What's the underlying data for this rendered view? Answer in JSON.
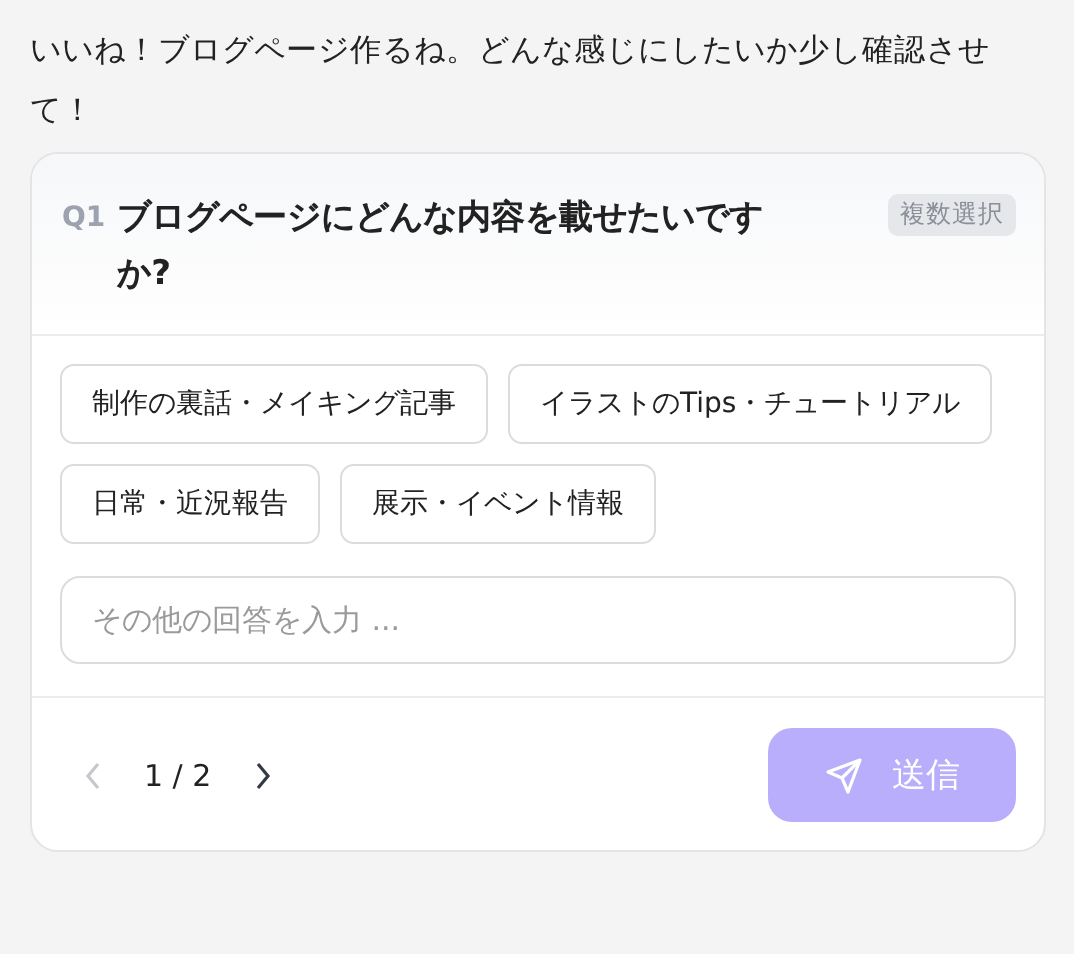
{
  "message": "いいね！ブログページ作るね。どんな感じにしたいか少し確認させて！",
  "question": {
    "number": "Q1",
    "title": "ブログページにどんな内容を載せたいですか?",
    "badge": "複数選択"
  },
  "options": [
    {
      "label": "制作の裏話・メイキング記事",
      "selected": false
    },
    {
      "label": "イラストのTips・チュートリアル",
      "selected": false
    },
    {
      "label": "日常・近況報告",
      "selected": false
    },
    {
      "label": "展示・イベント情報",
      "selected": false
    }
  ],
  "other_input": {
    "placeholder": "その他の回答を入力 ..."
  },
  "pager": {
    "text": "1 / 2",
    "prev_disabled": true,
    "next_disabled": false
  },
  "send_button": {
    "label": "送信",
    "disabled": true
  }
}
